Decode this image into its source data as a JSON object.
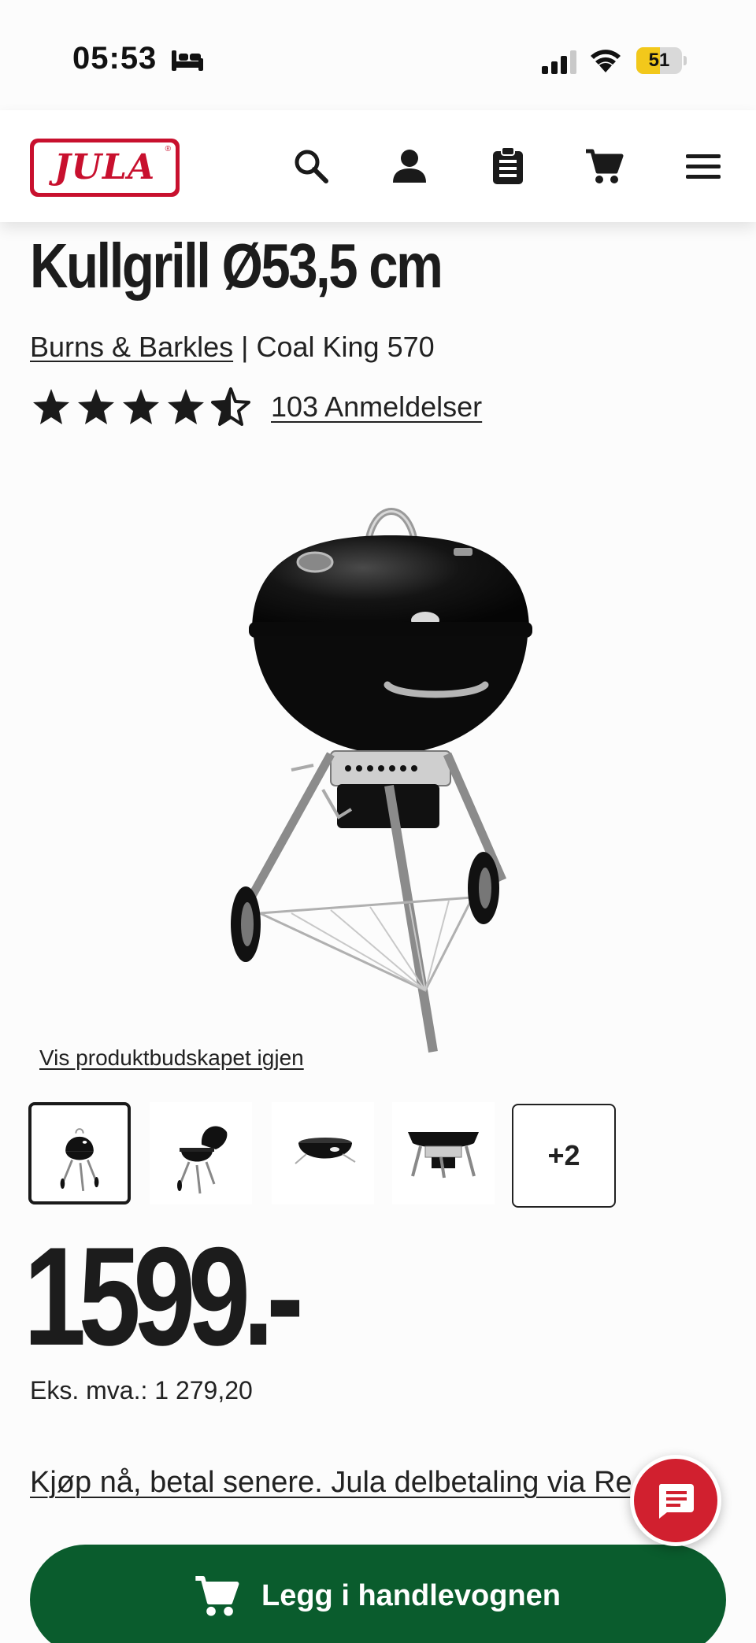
{
  "status_bar": {
    "time": "05:53",
    "battery_level": "51",
    "battery_fraction": 0.51,
    "battery_color": "#f2c81b"
  },
  "header": {
    "logo_text": "JULA",
    "logo_reg_mark": "®",
    "brand_color": "#c8102e",
    "icons": [
      "search-icon",
      "account-icon",
      "shopping-list-icon",
      "cart-icon",
      "menu-icon"
    ]
  },
  "product": {
    "title": "Kullgrill Ø53,5 cm",
    "brand": "Burns & Barkles",
    "separator": " | ",
    "model": "Coal King 570",
    "rating": 4.5,
    "rating_max": 5,
    "reviews_label": "103 Anmeldelser",
    "video_link": "Vis produktbudskapet igjen",
    "thumbnails_more_label": "+2",
    "thumbnails": [
      "grill-front",
      "grill-lid-open",
      "grill-bowl",
      "grill-detail"
    ]
  },
  "pricing": {
    "price": "1599.-",
    "vat_label": "Eks. mva.:",
    "vat_value": "1 279,20"
  },
  "finance": {
    "link_text": "Kjøp nå, betal senere. Jula delbetaling via Re"
  },
  "actions": {
    "add_to_cart_label": "Legg i handlevognen",
    "add_to_cart_color": "#0a5c2d",
    "chat_color": "#d1202f"
  }
}
